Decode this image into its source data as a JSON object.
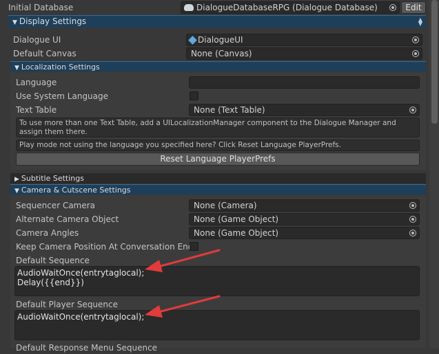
{
  "initial_database": {
    "label": "Initial Database",
    "value": "DialogueDatabaseRPG (Dialogue Database)",
    "edit_label": "Edit"
  },
  "display_settings": {
    "title": "Display Settings"
  },
  "dialogue_ui": {
    "label": "Dialogue UI",
    "value": "DialogueUI"
  },
  "default_canvas": {
    "label": "Default Canvas",
    "value": "None (Canvas)"
  },
  "localization": {
    "title": "Localization Settings",
    "language_label": "Language",
    "language_value": "",
    "use_system_language_label": "Use System Language",
    "text_table_label": "Text Table",
    "text_table_value": "None (Text Table)",
    "info_text": "To use more than one Text Table, add a UILocalizationManager component to the Dialogue Manager and assign them there.",
    "warning_text": "Play mode not using the language you specified here? Click Reset Language PlayerPrefs.",
    "reset_button_label": "Reset Language PlayerPrefs"
  },
  "subtitle_settings": {
    "title": "Subtitle Settings"
  },
  "camera": {
    "title": "Camera & Cutscene Settings",
    "sequencer_camera_label": "Sequencer Camera",
    "sequencer_camera_value": "None (Camera)",
    "alternate_camera_label": "Alternate Camera Object",
    "alternate_camera_value": "None (Game Object)",
    "camera_angles_label": "Camera Angles",
    "camera_angles_value": "None (Game Object)",
    "keep_position_label": "Keep Camera Position At Conversation End",
    "default_sequence_label": "Default Sequence",
    "default_sequence_line1": "AudioWaitOnce(entrytaglocal);",
    "default_sequence_line2": "Delay({{end}})",
    "default_player_sequence_label": "Default Player Sequence",
    "default_player_sequence_line1": "AudioWaitOnce(entrytaglocal);",
    "default_response_menu_label": "Default Response Menu Sequence"
  },
  "colors": {
    "background": "#383838",
    "header_blue": "#1e3f5a",
    "arrow_red": "#e23b3b"
  }
}
